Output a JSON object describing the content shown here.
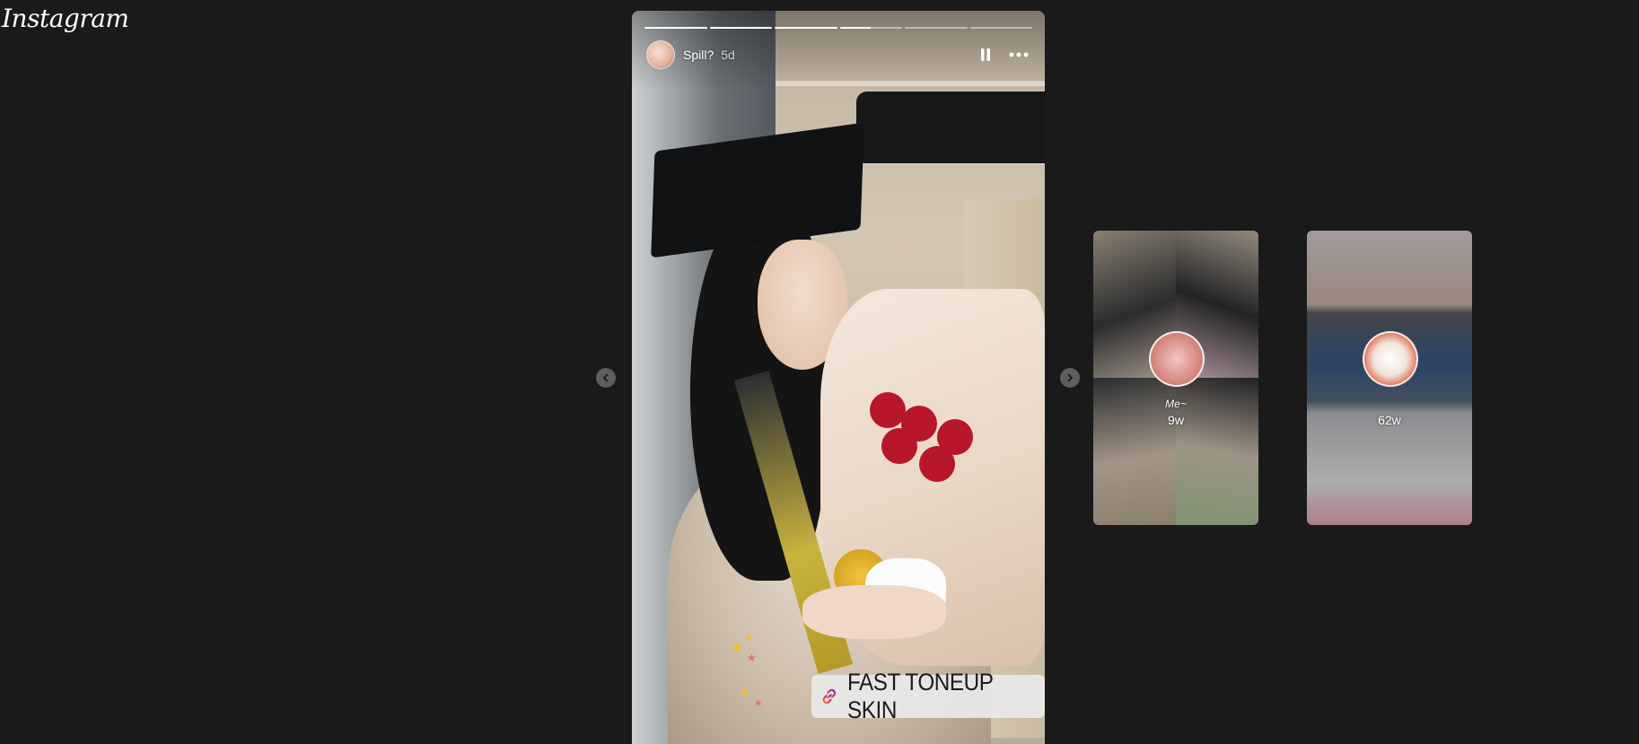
{
  "app": {
    "logo": "Instagram"
  },
  "story": {
    "username": "Spill?",
    "time": "5d",
    "progress": [
      1,
      1,
      1,
      0.5,
      0,
      0
    ],
    "link_sticker": "FAST TONEUP SKIN",
    "icons": [
      "pause-icon",
      "more-icon",
      "link-icon"
    ]
  },
  "navigation": {
    "prev_icon": "chevron-left-icon",
    "next_icon": "chevron-right-icon"
  },
  "previews": [
    {
      "name": "Me~",
      "time": "9w"
    },
    {
      "name": "",
      "time": "62w"
    }
  ]
}
